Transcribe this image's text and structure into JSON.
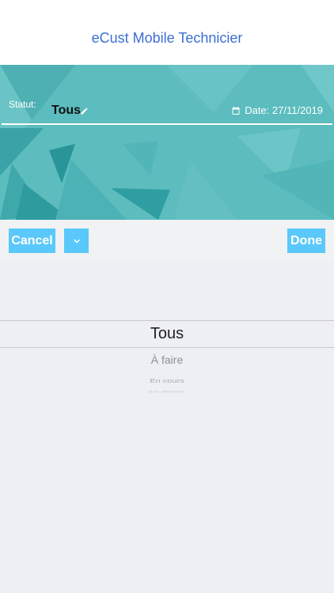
{
  "header": {
    "title": "eCust Mobile Technicier"
  },
  "filter": {
    "statut_label": "Statut:",
    "statut_value": "Tous",
    "date_label": "Date: 27/11/2019"
  },
  "toolbar": {
    "cancel_label": "Cancel",
    "done_label": "Done"
  },
  "picker": {
    "options": [
      "Tous",
      "À faire",
      "En cours",
      "En attente"
    ],
    "selected": "Tous"
  },
  "colors": {
    "accent": "#3b6fd1",
    "hero": "#5cbcbe",
    "button": "#5ac8fa"
  }
}
